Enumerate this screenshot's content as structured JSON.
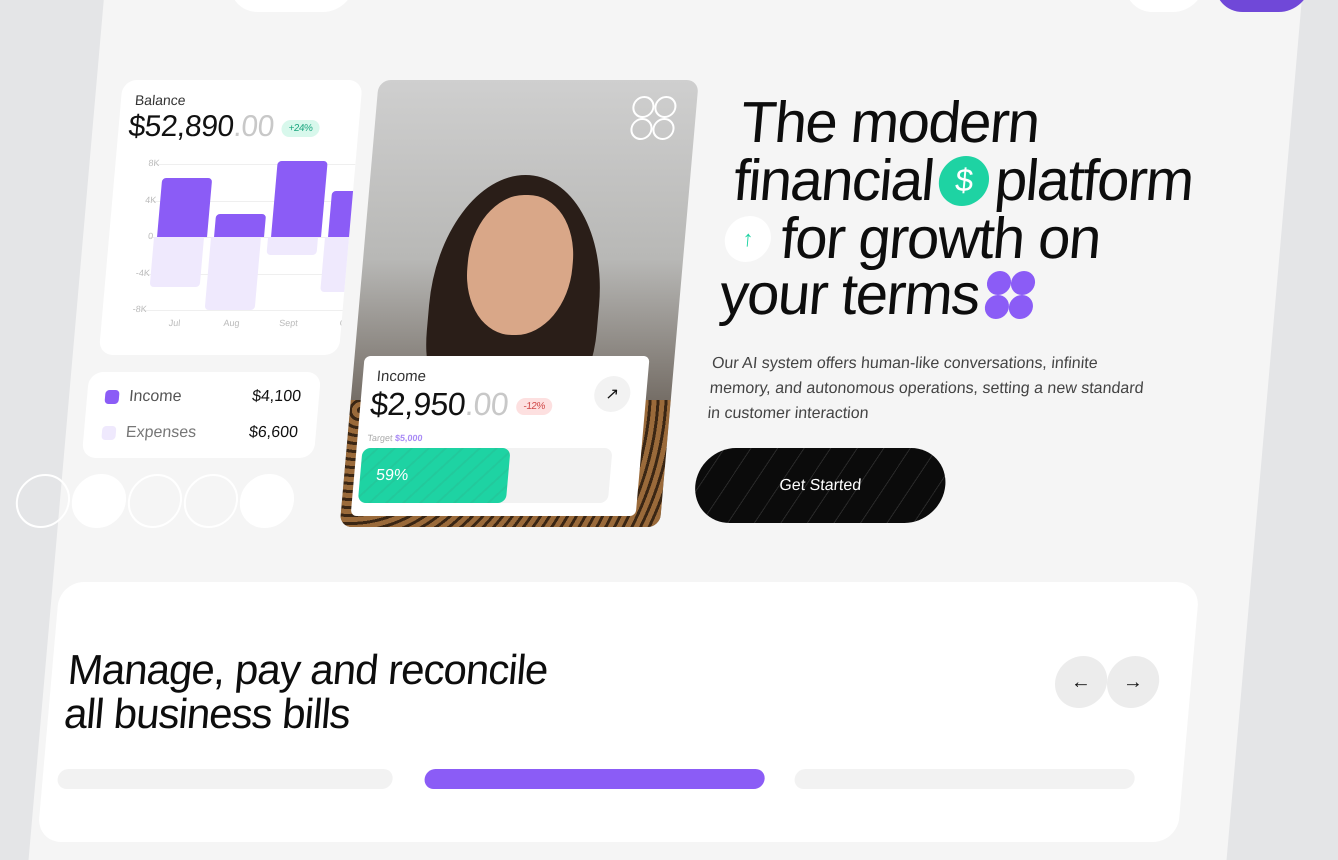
{
  "colors": {
    "accent": "#8b5cf6",
    "green": "#1ed3a3",
    "expense": "#efe9fd",
    "dark": "#0b0b0b",
    "red_badge": "#fde0e0"
  },
  "balance_card": {
    "label": "Balance",
    "amount": "$52,890",
    "cents": ".00",
    "change": "+24%"
  },
  "chart_data": {
    "type": "bar",
    "categories": [
      "Jul",
      "Aug",
      "Sept",
      "Ok"
    ],
    "series": [
      {
        "name": "Income",
        "values": [
          6500,
          2500,
          8300,
          5000
        ]
      },
      {
        "name": "Expenses",
        "values": [
          -5500,
          -8000,
          -2000,
          -6000
        ]
      }
    ],
    "y_ticks": [
      "8K",
      "4K",
      "0",
      "-4K",
      "-8K"
    ],
    "ylim": [
      -8000,
      8000
    ],
    "grid": true
  },
  "legend_card": {
    "items": [
      {
        "label": "Income",
        "value": "$4,100",
        "color": "#8b5cf6"
      },
      {
        "label": "Expenses",
        "value": "$6,600",
        "color": "#efe9fd"
      }
    ]
  },
  "income_card": {
    "label": "Income",
    "amount": "$2,950",
    "cents": ".00",
    "change": "-12%",
    "target_label": "Target",
    "target_value": "$5,000",
    "progress_percent": 59,
    "progress_label": "59%",
    "icon": "arrow-up-right-icon"
  },
  "hero": {
    "line1": "The modern",
    "line2a": "financial",
    "line2b": "platform",
    "line3": "for growth on",
    "line4": "your terms",
    "description": "Our AI system offers human-like conversations, infinite memory, and autonomous operations, setting a new standard in customer interaction",
    "cta": "Get Started",
    "icons": [
      "dollar-icon",
      "arrow-up-icon",
      "clover-icon"
    ]
  },
  "section": {
    "title_line1": "Manage, pay and reconcile",
    "title_line2": "all business bills",
    "prev": "←",
    "next": "→"
  }
}
